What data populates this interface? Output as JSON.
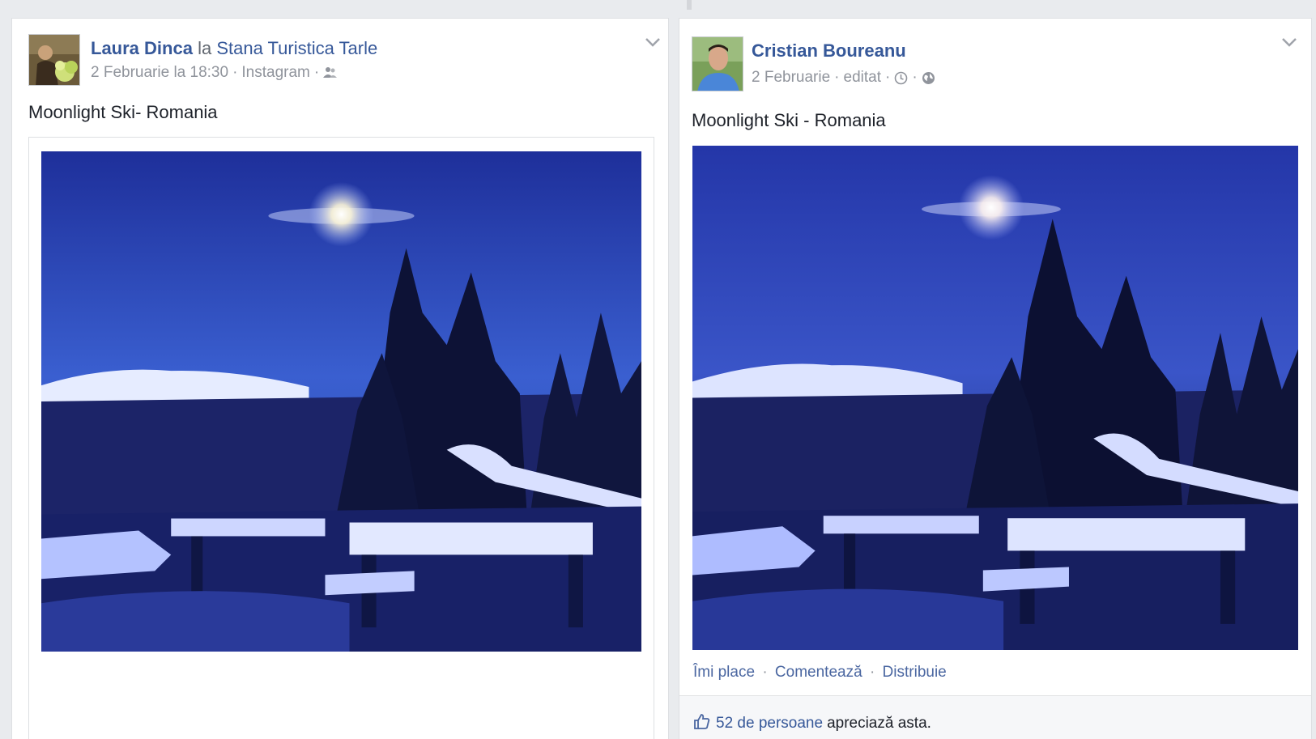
{
  "posts": [
    {
      "author": "Laura Dinca",
      "conjunction": "la",
      "place": "Stana Turistica Tarle",
      "date": "2 Februarie la 18:30",
      "source": "Instagram",
      "text": "Moonlight Ski- Romania",
      "audience_icon": "friends-icon"
    },
    {
      "author": "Cristian Boureanu",
      "date": "2 Februarie",
      "edited": "editat",
      "text": "Moonlight Ski - Romania",
      "audience_icon": "globe-icon",
      "actions": {
        "like": "Îmi place",
        "comment": "Comentează",
        "share": "Distribuie"
      },
      "likes_count": "52 de persoane",
      "likes_suffix": "apreciază asta."
    }
  ],
  "colors": {
    "link": "#365899",
    "meta": "#90949c",
    "background": "#e9ebee",
    "sky": "#2a3fb0"
  }
}
